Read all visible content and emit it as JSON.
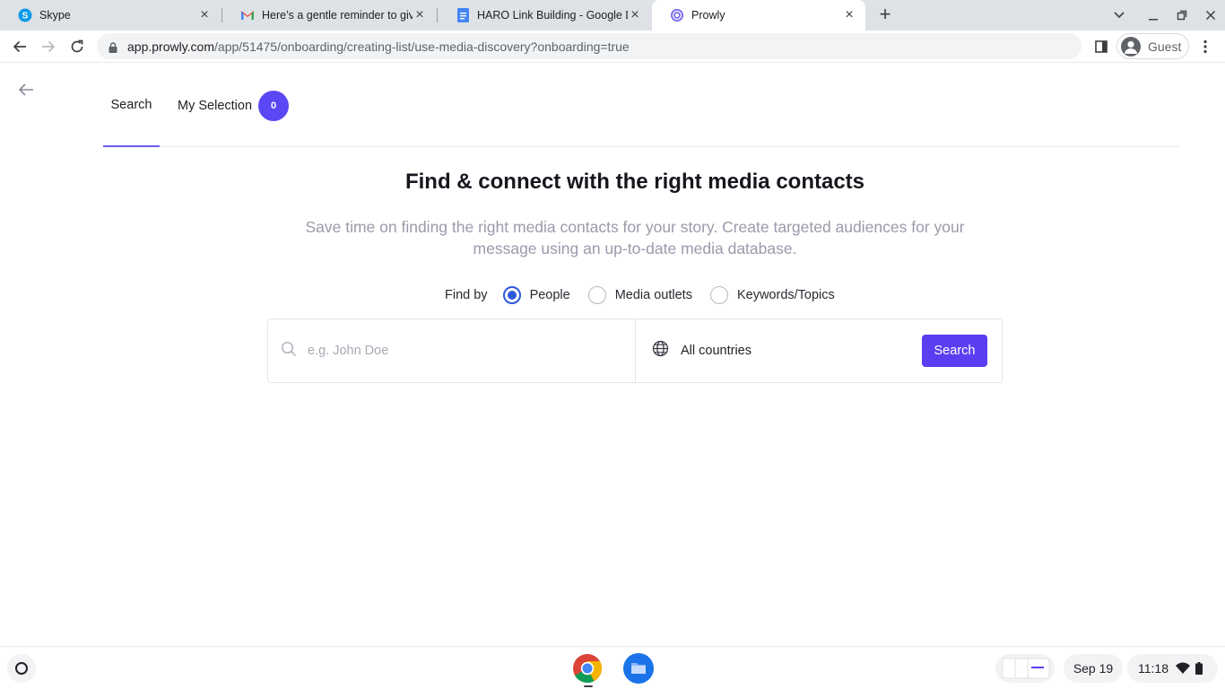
{
  "browser": {
    "tabs": [
      {
        "title": "Skype",
        "favicon": "skype-icon"
      },
      {
        "title": "Here’s a gentle reminder to give y",
        "favicon": "gmail-icon"
      },
      {
        "title": "HARO Link Building - Google Doc",
        "favicon": "google-docs-icon"
      },
      {
        "title": "Prowly",
        "favicon": "prowly-icon"
      }
    ],
    "url_domain": "app.prowly.com",
    "url_path": "/app/51475/onboarding/creating-list/use-media-discovery?onboarding=true",
    "profile_label": "Guest"
  },
  "page": {
    "tabs": [
      {
        "label": "Search"
      },
      {
        "label": "My Selection",
        "count": "0"
      }
    ],
    "headline": "Find & connect with the right media contacts",
    "subtext": "Save time on finding the right media contacts for your story. Create targeted audiences for your message using an up-to-date media database.",
    "find_by_label": "Find by",
    "find_by_options": [
      {
        "label": "People",
        "checked": true
      },
      {
        "label": "Media outlets",
        "checked": false
      },
      {
        "label": "Keywords/Topics",
        "checked": false
      }
    ],
    "search_placeholder": "e.g. John Doe",
    "country": "All countries",
    "search_button": "Search"
  },
  "shelf": {
    "date": "Sep 19",
    "time": "11:18"
  },
  "colors": {
    "accent": "#5a3ef2",
    "radio": "#2b59d9"
  }
}
